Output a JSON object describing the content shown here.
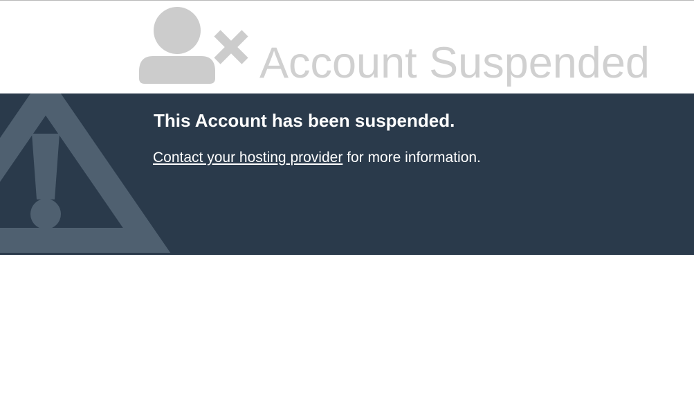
{
  "header": {
    "title": "Account Suspended",
    "icon": "user-x-icon",
    "title_color": "#d0d0d0",
    "icon_color": "#cccccc"
  },
  "banner": {
    "heading": "This Account has been suspended.",
    "link_text": "Contact your hosting provider",
    "suffix_text": " for more information.",
    "icon": "warning-triangle-icon",
    "background_color": "#2a3a4b",
    "icon_color": "#4f6070",
    "text_color": "#ffffff"
  }
}
